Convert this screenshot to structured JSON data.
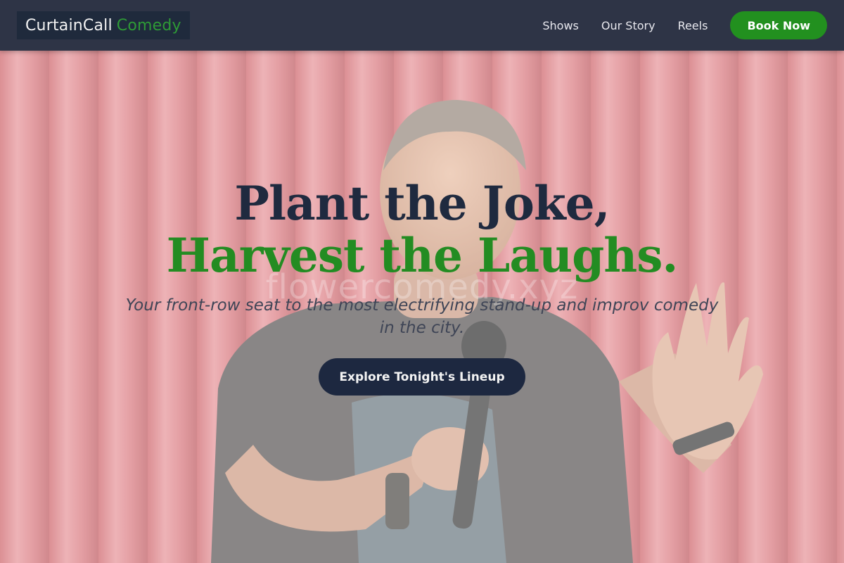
{
  "header": {
    "logo_part1": "CurtainCall",
    "logo_part2": "Comedy",
    "nav": [
      {
        "label": "Shows"
      },
      {
        "label": "Our Story"
      },
      {
        "label": "Reels"
      }
    ],
    "cta_label": "Book Now"
  },
  "hero": {
    "headline_line1": "Plant the Joke,",
    "headline_line2": "Harvest the Laughs.",
    "watermark": "flowercomedy.xyz",
    "subtitle": "Your front-row seat to the most electrifying stand-up and improv comedy in the city.",
    "cta_label": "Explore Tonight's Lineup",
    "background_image": "comedian-on-stage-photo"
  },
  "colors": {
    "nav_bg": "#2e3446",
    "accent_green": "#238c22",
    "dark_navy": "#1f2a3f",
    "curtain_red": "#d97a80"
  }
}
